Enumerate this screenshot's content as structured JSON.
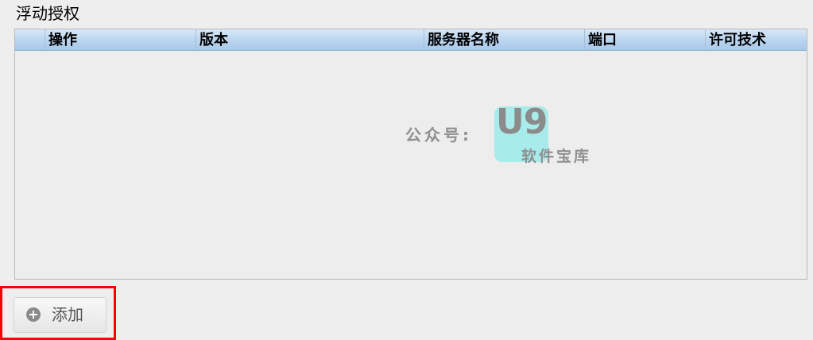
{
  "section": {
    "title": "浮动授权"
  },
  "table": {
    "columns": [
      "",
      "操作",
      "版本",
      "服务器名称",
      "端口",
      "许可技术"
    ],
    "rows": []
  },
  "watermark": {
    "prefix": "公众号:",
    "logo": "U9",
    "subtitle": "软件宝库",
    "badge_color": "#a7ecea"
  },
  "actions": {
    "add_label": "添加",
    "add_icon": "plus-circle-icon",
    "highlight_color": "#ff0000"
  }
}
